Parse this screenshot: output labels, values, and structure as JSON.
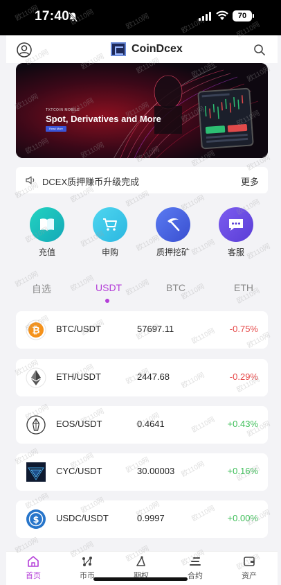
{
  "status_bar": {
    "time": "17:40",
    "battery": "70"
  },
  "header": {
    "app_name": "CoinDcex"
  },
  "banner": {
    "small_text": "TXTCOIN MOBILE",
    "title": "Spot, Derivatives and More",
    "button": "Read More"
  },
  "notice": {
    "text": "DCEX质押赚币升级完成",
    "more": "更多"
  },
  "quick_actions": [
    {
      "label": "充值",
      "icon": "book-icon",
      "color": "#22c3bf"
    },
    {
      "label": "申购",
      "icon": "cart-icon",
      "color": "#3ec8e6"
    },
    {
      "label": "质押挖矿",
      "icon": "pickaxe-icon",
      "color": "#4a63e0"
    },
    {
      "label": "客服",
      "icon": "chat-icon",
      "color": "#6b4fe0"
    }
  ],
  "tabs": [
    "自选",
    "USDT",
    "BTC",
    "ETH"
  ],
  "active_tab": "USDT",
  "market": [
    {
      "pair": "BTC/USDT",
      "price": "57697.11",
      "change": "-0.75%",
      "direction": "down",
      "icon": "bitcoin-icon"
    },
    {
      "pair": "ETH/USDT",
      "price": "2447.68",
      "change": "-0.29%",
      "direction": "down",
      "icon": "ethereum-icon"
    },
    {
      "pair": "EOS/USDT",
      "price": "0.4641",
      "change": "+0.43%",
      "direction": "up",
      "icon": "eos-icon"
    },
    {
      "pair": "CYC/USDT",
      "price": "30.00003",
      "change": "+0.16%",
      "direction": "up",
      "icon": "cyc-icon"
    },
    {
      "pair": "USDC/USDT",
      "price": "0.9997",
      "change": "+0.00%",
      "direction": "up",
      "icon": "usdc-icon"
    }
  ],
  "bottom_nav": [
    {
      "label": "首页",
      "icon": "home-icon",
      "active": true
    },
    {
      "label": "币币",
      "icon": "spot-icon",
      "active": false
    },
    {
      "label": "期权",
      "icon": "options-icon",
      "active": false
    },
    {
      "label": "合约",
      "icon": "contract-icon",
      "active": false
    },
    {
      "label": "资产",
      "icon": "wallet-icon",
      "active": false
    }
  ],
  "watermark": "欧110网",
  "colors": {
    "accent": "#b43fd8",
    "positive": "#3fbf5a",
    "negative": "#e64a4a"
  }
}
